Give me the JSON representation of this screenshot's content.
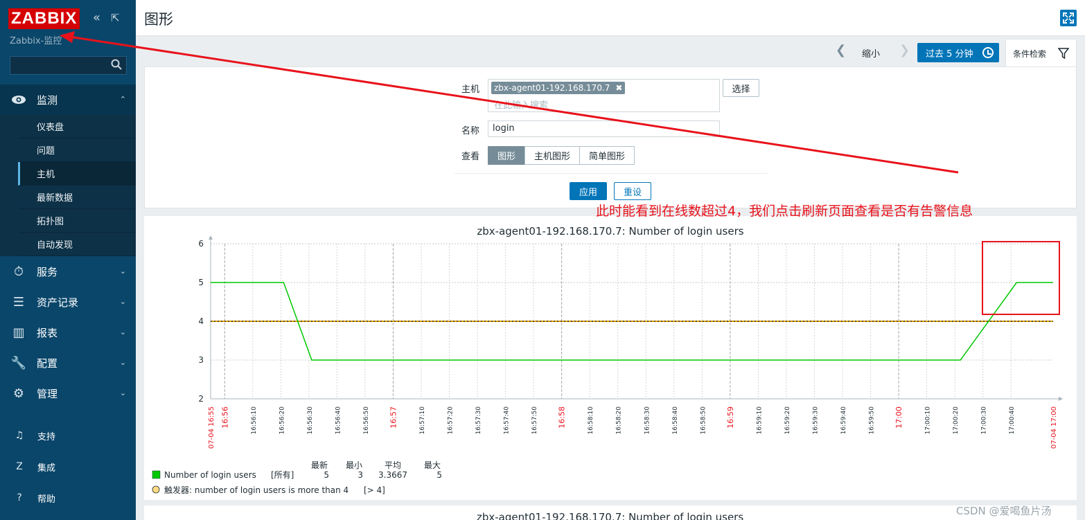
{
  "app": {
    "logo": "ZABBIX",
    "server_name": "Zabbix-监控",
    "collapse_icon": "«",
    "expand_icon": "⇱"
  },
  "sidebar": {
    "search_placeholder": "",
    "monitoring": {
      "label": "监测",
      "icon": "eye-icon",
      "items": [
        "仪表盘",
        "问题",
        "主机",
        "最新数据",
        "拓扑图",
        "自动发现"
      ],
      "active_item": "主机"
    },
    "menus": [
      {
        "label": "服务",
        "icon": "stopwatch-icon",
        "glyph": "⏱"
      },
      {
        "label": "资产记录",
        "icon": "list-icon",
        "glyph": "☰"
      },
      {
        "label": "报表",
        "icon": "bar-chart-icon",
        "glyph": "▥"
      },
      {
        "label": "配置",
        "icon": "wrench-icon",
        "glyph": "🔧"
      },
      {
        "label": "管理",
        "icon": "gear-icon",
        "glyph": "⚙"
      }
    ],
    "bottom": [
      {
        "label": "支持",
        "icon": "headset-icon",
        "glyph": "♫"
      },
      {
        "label": "集成",
        "icon": "z-icon",
        "glyph": "Z"
      },
      {
        "label": "帮助",
        "icon": "question-icon",
        "glyph": "?"
      }
    ]
  },
  "header": {
    "title": "图形"
  },
  "timebar": {
    "zoom_out": "缩小",
    "period": "过去 5 分钟",
    "filter_tab": "条件检索"
  },
  "filter": {
    "host_label": "主机",
    "host_chip": "zbx-agent01-192.168.170.7",
    "host_placeholder": "在此输入搜索",
    "select_button": "选择",
    "name_label": "名称",
    "name_value": "login",
    "view_label": "查看",
    "view_options": [
      "图形",
      "主机图形",
      "简单图形"
    ],
    "view_selected": "图形",
    "apply": "应用",
    "reset": "重设"
  },
  "annotation": {
    "text": "此时能看到在线数超过4，我们点击刷新页面查看是否有告警信息"
  },
  "chart_data": {
    "type": "line",
    "title": "zbx-agent01-192.168.170.7: Number of login users",
    "ylim": [
      2,
      6
    ],
    "yticks": [
      "6",
      "5",
      "4",
      "3",
      "2"
    ],
    "x_start_label": "07-04 16:55",
    "x_end_label": "07-04 17:00",
    "x_tick_labels": [
      "16:56",
      "16:56:10",
      "16:56:20",
      "16:56:30",
      "16:56:40",
      "16:56:50",
      "16:57",
      "16:57:10",
      "16:57:20",
      "16:57:30",
      "16:57:40",
      "16:57:50",
      "16:58",
      "16:58:10",
      "16:58:20",
      "16:58:30",
      "16:58:40",
      "16:58:50",
      "16:59",
      "16:59:10",
      "16:59:20",
      "16:59:30",
      "16:59:40",
      "16:59:50",
      "17:00",
      "17:00:10",
      "17:00:20",
      "17:00:30",
      "17:00:40"
    ],
    "red_ticks": [
      "16:56",
      "16:57",
      "16:58",
      "16:59",
      "17:00"
    ],
    "series": [
      {
        "name": "Number of login users",
        "color": "#00c800",
        "points": [
          [
            0,
            5
          ],
          [
            26,
            5
          ],
          [
            36,
            3
          ],
          [
            267,
            3
          ],
          [
            287,
            5
          ],
          [
            300,
            5
          ]
        ]
      }
    ],
    "trigger": {
      "value": 4,
      "color": "#e0a000"
    },
    "legend": {
      "headers": [
        "最新",
        "最小",
        "平均",
        "最大"
      ],
      "series_label": "Number of login users",
      "series_scope": "[所有]",
      "latest": "5",
      "min": "3",
      "avg": "3.3667",
      "max": "5",
      "trigger_label": "触发器: number of login users is more than 4",
      "trigger_cond": "[> 4]"
    }
  },
  "graph2_title": "zbx-agent01-192.168.170.7: Number of login users",
  "watermark": "CSDN @爱喝鱼片汤"
}
